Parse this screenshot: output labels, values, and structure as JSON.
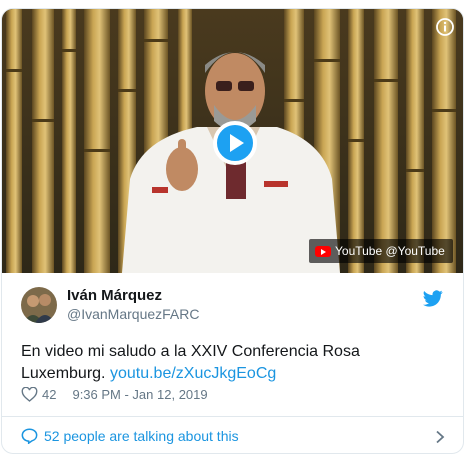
{
  "media": {
    "youtube_label": "YouTube @YouTube",
    "info_icon": "info-icon",
    "play_icon": "play-icon"
  },
  "author": {
    "display_name": "Iván Márquez",
    "handle": "@IvanMarquezFARC"
  },
  "tweet": {
    "text": "En video mi saludo a la XXIV Conferencia Rosa Luxemburg.",
    "link": "youtu.be/zXucJkgEoCg"
  },
  "meta": {
    "likes": "42",
    "timestamp": "9:36 PM - Jan 12, 2019"
  },
  "footer": {
    "talking_label": "52 people are talking about this"
  },
  "colors": {
    "accent": "#1b95e0",
    "muted": "#657786",
    "border": "#e1e8ed",
    "youtube_red": "#ff0000"
  }
}
